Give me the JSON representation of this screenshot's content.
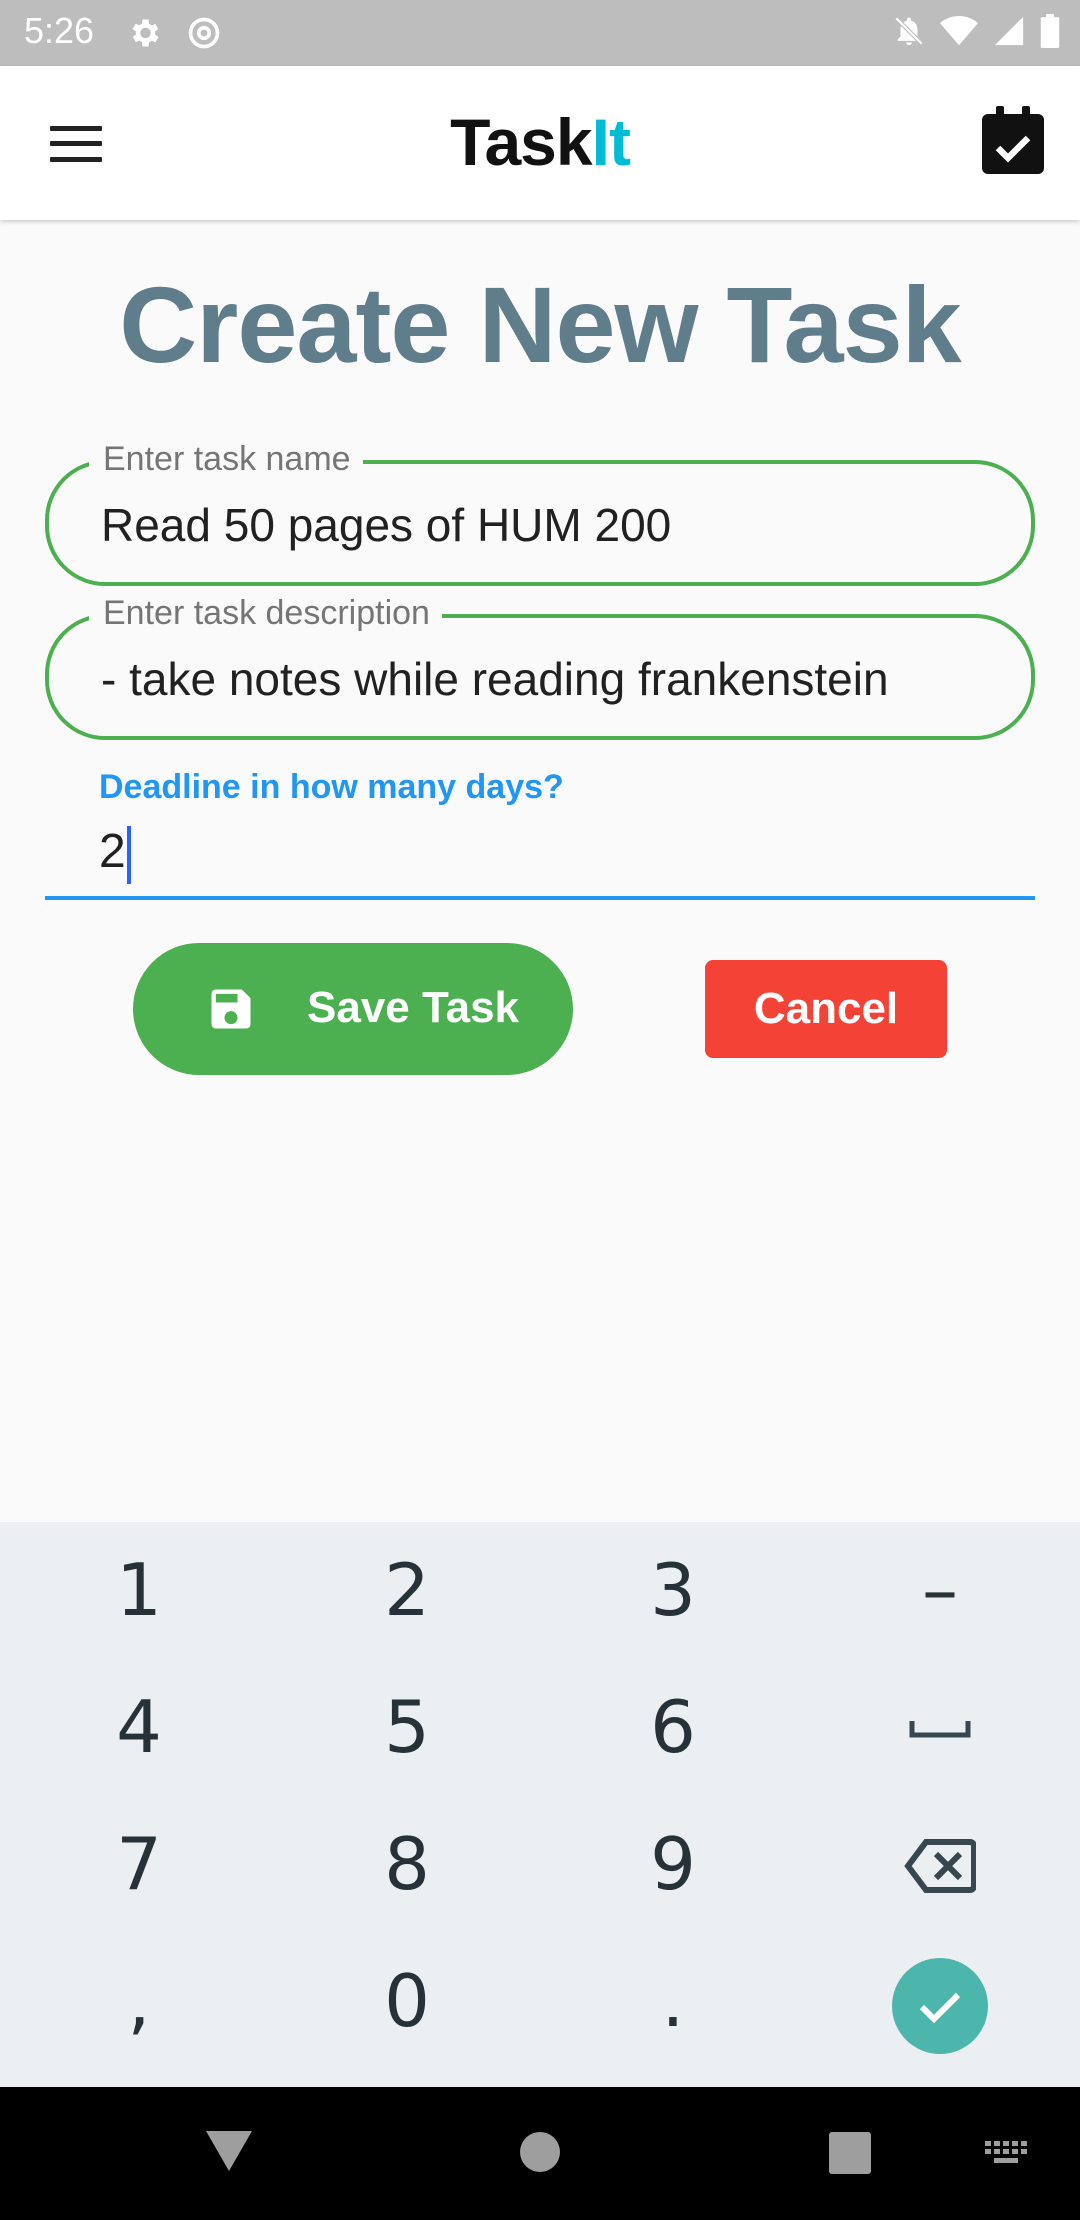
{
  "status_bar": {
    "time": "5:26"
  },
  "app_bar": {
    "title_main": "Task",
    "title_accent": "It",
    "accent_color": "#00bcd4"
  },
  "page": {
    "title": "Create New Task"
  },
  "form": {
    "task_name": {
      "label": "Enter task name",
      "value": "Read 50 pages of HUM 200"
    },
    "task_description": {
      "label": "Enter task description",
      "value": "- take notes while reading frankenstein"
    },
    "deadline": {
      "label": "Deadline in how many days?",
      "value": "2"
    }
  },
  "buttons": {
    "save_label": "Save Task",
    "cancel_label": "Cancel"
  },
  "keyboard": {
    "keys": [
      "1",
      "2",
      "3",
      "–",
      "4",
      "5",
      "6",
      "␣",
      "7",
      "8",
      "9",
      "⌫",
      ",",
      "0",
      ".",
      "✓"
    ]
  },
  "colors": {
    "primary_green": "#4caf50",
    "cancel_red": "#f44336",
    "focus_blue": "#2196f3",
    "title_gray": "#607d8b"
  }
}
